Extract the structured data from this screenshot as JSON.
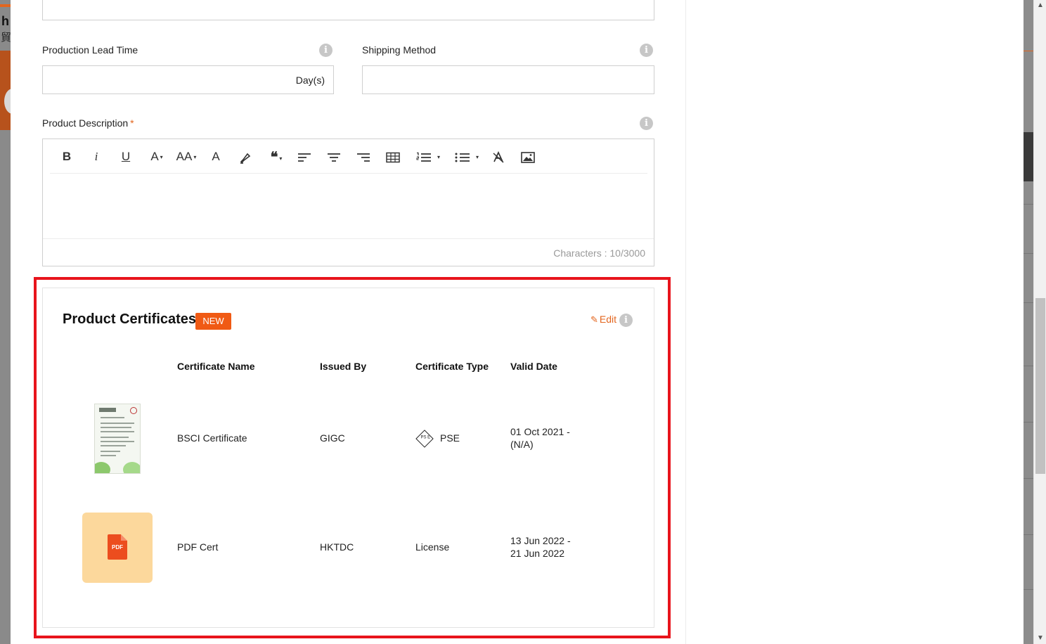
{
  "background": {
    "logo_letter": "h",
    "logo_char": "貿"
  },
  "form": {
    "production_lead_time": {
      "label": "Production Lead Time",
      "value": "",
      "suffix": "Day(s)"
    },
    "shipping_method": {
      "label": "Shipping Method",
      "value": ""
    },
    "product_description": {
      "label": "Product Description",
      "required_mark": "*",
      "characters": "Characters : 10/3000"
    }
  },
  "toolbar": {
    "bold": "B",
    "italic": "i",
    "underline": "U",
    "font_color": "A",
    "font_size": "AA",
    "fill_color": "A",
    "caret": "▾"
  },
  "certificates": {
    "title": "Product Certificates",
    "badge": "NEW",
    "edit_label": "Edit",
    "columns": [
      "Certificate Name",
      "Issued By",
      "Certificate Type",
      "Valid Date"
    ],
    "rows": [
      {
        "name": "BSCI Certificate",
        "issued_by": "GIGC",
        "type": "PSE",
        "type_icon": "pse-mark-icon",
        "valid_line1": "01 Oct 2021 -",
        "valid_line2": "(N/A)",
        "thumbnail": "certificate-image"
      },
      {
        "name": "PDF Cert",
        "issued_by": "HKTDC",
        "type": "License",
        "valid_line1": "13 Jun 2022 -",
        "valid_line2": "21 Jun 2022",
        "thumbnail": "pdf-file-icon",
        "thumbnail_label": "PDF"
      }
    ]
  },
  "colors": {
    "accent": "#e3661f",
    "badge_bg": "#f05a14",
    "highlight_border": "#e8141c",
    "pdf_tile": "#fcd89c",
    "pdf_doc": "#ec4d1e"
  }
}
